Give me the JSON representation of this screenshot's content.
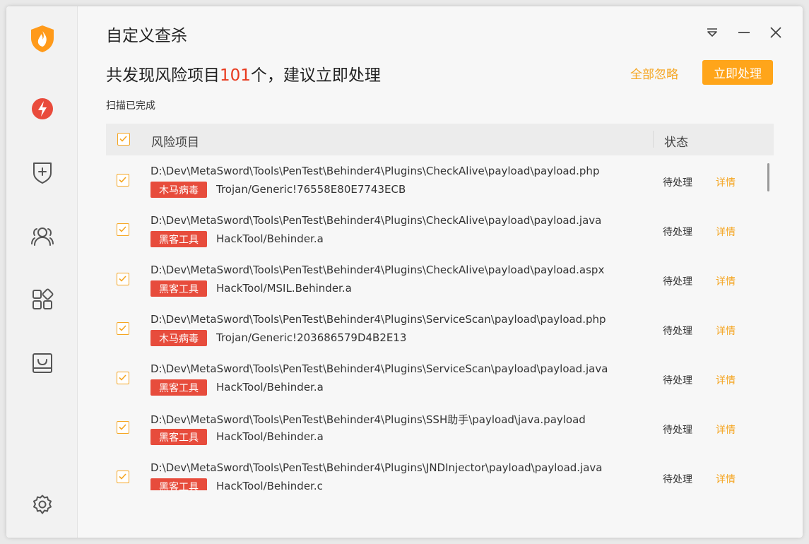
{
  "window": {
    "title": "自定义查杀"
  },
  "sidebar": {
    "items": [
      {
        "icon": "shield-flame-logo-icon"
      },
      {
        "icon": "lightning-scan-icon"
      },
      {
        "icon": "shield-plus-icon"
      },
      {
        "icon": "users-icon"
      },
      {
        "icon": "apps-grid-icon"
      },
      {
        "icon": "tray-icon"
      },
      {
        "icon": "gear-icon"
      }
    ]
  },
  "header": {
    "headline_prefix": "共发现风险项目",
    "headline_count": "101",
    "headline_suffix": "个，建议立即处理",
    "ignore_all_label": "全部忽略",
    "handle_now_label": "立即处理",
    "scan_status": "扫描已完成"
  },
  "table": {
    "columns": {
      "risk": "风险项目",
      "status": "状态"
    },
    "rows": [
      {
        "path": "D:\\Dev\\MetaSword\\Tools\\PenTest\\Behinder4\\Plugins\\CheckAlive\\payload\\payload.php",
        "tag": "木马病毒",
        "threat": "Trojan/Generic!76558E80E7743ECB",
        "status": "待处理",
        "detail": "详情"
      },
      {
        "path": "D:\\Dev\\MetaSword\\Tools\\PenTest\\Behinder4\\Plugins\\CheckAlive\\payload\\payload.java",
        "tag": "黑客工具",
        "threat": "HackTool/Behinder.a",
        "status": "待处理",
        "detail": "详情"
      },
      {
        "path": "D:\\Dev\\MetaSword\\Tools\\PenTest\\Behinder4\\Plugins\\CheckAlive\\payload\\payload.aspx",
        "tag": "黑客工具",
        "threat": "HackTool/MSIL.Behinder.a",
        "status": "待处理",
        "detail": "详情"
      },
      {
        "path": "D:\\Dev\\MetaSword\\Tools\\PenTest\\Behinder4\\Plugins\\ServiceScan\\payload\\payload.php",
        "tag": "木马病毒",
        "threat": "Trojan/Generic!203686579D4B2E13",
        "status": "待处理",
        "detail": "详情"
      },
      {
        "path": "D:\\Dev\\MetaSword\\Tools\\PenTest\\Behinder4\\Plugins\\ServiceScan\\payload\\payload.java",
        "tag": "黑客工具",
        "threat": "HackTool/Behinder.a",
        "status": "待处理",
        "detail": "详情"
      },
      {
        "path": "D:\\Dev\\MetaSword\\Tools\\PenTest\\Behinder4\\Plugins\\SSH助手\\payload\\java.payload",
        "tag": "黑客工具",
        "threat": "HackTool/Behinder.a",
        "status": "待处理",
        "detail": "详情"
      },
      {
        "path": "D:\\Dev\\MetaSword\\Tools\\PenTest\\Behinder4\\Plugins\\JNDInjector\\payload\\payload.java",
        "tag": "黑客工具",
        "threat": "HackTool/Behinder.c",
        "status": "待处理",
        "detail": "详情"
      }
    ]
  },
  "colors": {
    "accent": "#ffa51a",
    "danger": "#e74c3c",
    "count_red": "#e8391d"
  }
}
